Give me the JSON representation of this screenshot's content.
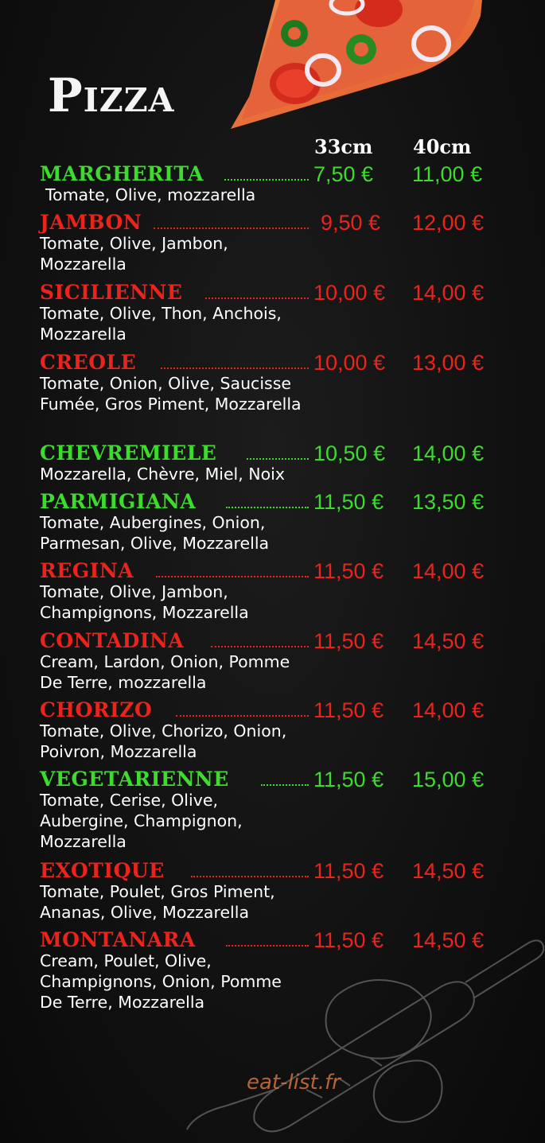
{
  "title": "Pizza",
  "sizes": {
    "small": "33cm",
    "large": "40cm"
  },
  "items": [
    {
      "name": "MARGHERITA",
      "price_33": "7,50 €",
      "price_40": "11,00 €",
      "desc": "Tomate, Olive, mozzarella",
      "color": "#3ddb2d"
    },
    {
      "name": "JAMBON",
      "price_33": "9,50 €",
      "price_40": "12,00 €",
      "desc": "Tomate, Olive, Jambon, Mozzarella",
      "color": "#e8241c"
    },
    {
      "name": "SICILIENNE",
      "price_33": "10,00 €",
      "price_40": "14,00 €",
      "desc": "Tomate, Olive, Thon, Anchois, Mozzarella",
      "color": "#e8241c"
    },
    {
      "name": "CREOLE",
      "price_33": "10,00 €",
      "price_40": "13,00 €",
      "desc": "Tomate, Onion, Olive, Saucisse Fumée, Gros Piment, Mozzarella",
      "color": "#e8241c"
    },
    {
      "name": "CHEVREMIELE",
      "price_33": "10,50 €",
      "price_40": "14,00 €",
      "desc": "Mozzarella, Chèvre, Miel, Noix",
      "color": "#3ddb2d"
    },
    {
      "name": "PARMIGIANA",
      "price_33": "11,50 €",
      "price_40": "13,50 €",
      "desc": "Tomate, Aubergines, Onion, Parmesan, Olive, Mozzarella",
      "color": "#3ddb2d"
    },
    {
      "name": "REGINA",
      "price_33": "11,50 €",
      "price_40": "14,00 €",
      "desc": "Tomate, Olive, Jambon, Champignons, Mozzarella",
      "color": "#e8241c"
    },
    {
      "name": "CONTADINA",
      "price_33": "11,50 €",
      "price_40": "14,50 €",
      "desc": "Cream, Lardon, Onion, Pomme De Terre, mozzarella",
      "color": "#e8241c"
    },
    {
      "name": "CHORIZO",
      "price_33": "11,50 €",
      "price_40": "14,00 €",
      "desc": "Tomate, Olive, Chorizo, Onion, Poivron, Mozzarella",
      "color": "#e8241c"
    },
    {
      "name": "VEGETARIENNE",
      "price_33": "11,50 €",
      "price_40": "15,00 €",
      "desc": "Tomate, Cerise, Olive, Aubergine, Champignon, Mozzarella",
      "color": "#3ddb2d"
    },
    {
      "name": "EXOTIQUE",
      "price_33": "11,50 €",
      "price_40": "14,50 €",
      "desc": "Tomate, Poulet, Gros Piment, Ananas, Olive, Mozzarella",
      "color": "#e8241c"
    },
    {
      "name": "MONTANARA",
      "price_33": "11,50 €",
      "price_40": "14,50 €",
      "desc": "Cream, Poulet, Olive, Champignons, Onion, Pomme De Terre, Mozzarella",
      "color": "#e8241c"
    }
  ],
  "watermark": "eat-list.fr",
  "icons": {
    "decoration_top": "pizza-slice-icon",
    "decoration_bottom": "rolling-pin-icon"
  }
}
